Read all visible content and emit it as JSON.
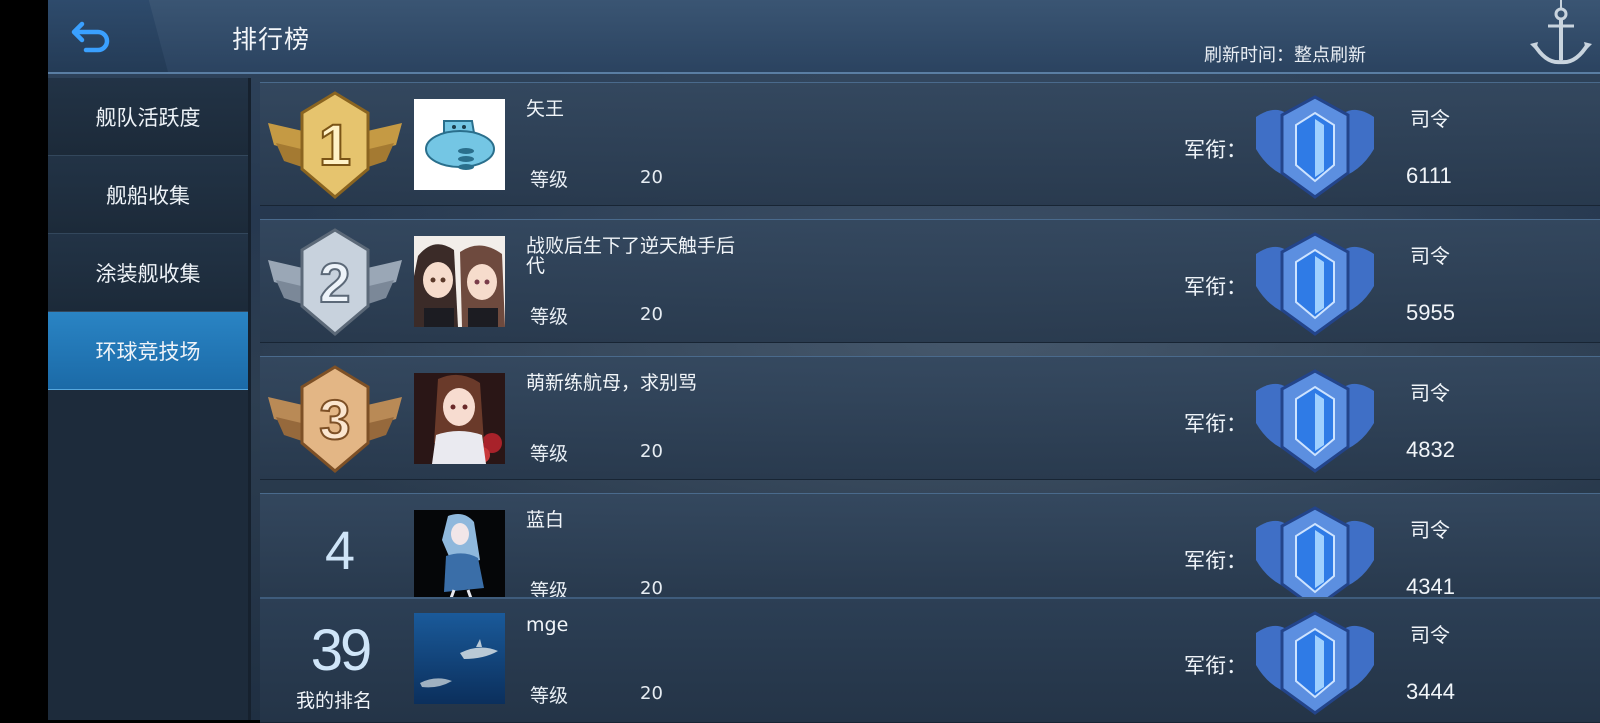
{
  "header": {
    "title": "排行榜",
    "refresh_text": "刷新时间：整点刷新"
  },
  "sidebar": {
    "tabs": [
      {
        "label": "舰队活跃度",
        "active": false
      },
      {
        "label": "舰船收集",
        "active": false
      },
      {
        "label": "涂装舰收集",
        "active": false
      },
      {
        "label": "环球竞技场",
        "active": true
      }
    ]
  },
  "leaderboard": {
    "level_label": "等级",
    "rank_label": "军衔：",
    "entries": [
      {
        "rank": "1",
        "name": "矢王",
        "level": "20",
        "title": "司令",
        "score": "6111",
        "medal": "gold-1-medal",
        "avatar": "cartoon-submarine-avatar"
      },
      {
        "rank": "2",
        "name": "战败后生下了逆天触手后代",
        "name_line1": "战败后生下了逆天触手后",
        "name_line2": "代",
        "level": "20",
        "title": "司令",
        "score": "5955",
        "medal": "silver-2-medal",
        "avatar": "anime-girls-avatar"
      },
      {
        "rank": "3",
        "name": "萌新练航母，求别骂",
        "level": "20",
        "title": "司令",
        "score": "4832",
        "medal": "bronze-3-medal",
        "avatar": "anime-girl-avatar"
      },
      {
        "rank": "4",
        "name": "蓝白",
        "level": "20",
        "title": "司令",
        "score": "4341",
        "avatar": "blue-white-character-avatar"
      }
    ]
  },
  "my_rank": {
    "rank": "39",
    "label": "我的排名",
    "name": "mge",
    "level": "20",
    "title": "司令",
    "score": "3444",
    "avatar": "shark-ocean-avatar"
  },
  "colors": {
    "active_tab": "#2a84c4",
    "header": "#3a5573",
    "row": "#34485f"
  }
}
